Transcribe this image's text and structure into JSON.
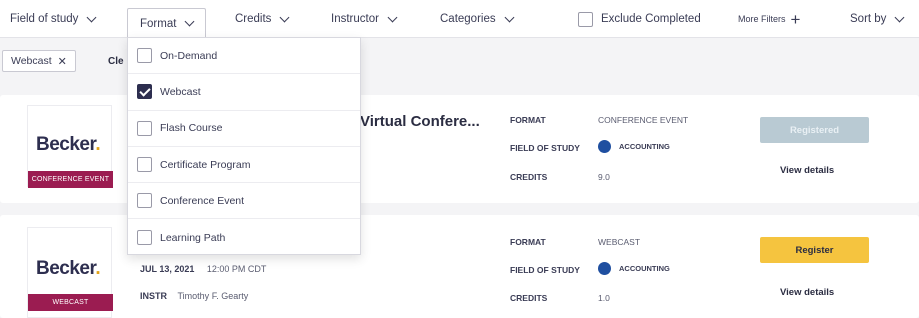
{
  "filter_bar": {
    "field_of_study": "Field of study",
    "format": "Format",
    "credits": "Credits",
    "instructor": "Instructor",
    "categories": "Categories",
    "exclude_completed": "Exclude Completed",
    "more_filters": "More Filters",
    "sort_by": "Sort by"
  },
  "active_filters": {
    "chip_label": "Webcast",
    "chip_remove": "✕",
    "clear_label": "Cle"
  },
  "format_dropdown": {
    "options": [
      {
        "label": "On-Demand",
        "checked": false
      },
      {
        "label": "Webcast",
        "checked": true
      },
      {
        "label": "Flash Course",
        "checked": false
      },
      {
        "label": "Certificate Program",
        "checked": false
      },
      {
        "label": "Conference Event",
        "checked": false
      },
      {
        "label": "Learning Path",
        "checked": false
      }
    ]
  },
  "courses": [
    {
      "logo": "Becker",
      "logo_dot": ".",
      "logo_band": "CONFERENCE EVENT",
      "title": "Virtual Confere...",
      "format_label": "FORMAT",
      "format_value": "CONFERENCE EVENT",
      "field_label": "FIELD OF STUDY",
      "field_value": "ACCOUNTING",
      "credits_label": "CREDITS",
      "credits_value": "9.0",
      "button": "Registered",
      "details": "View details"
    },
    {
      "logo": "Becker",
      "logo_dot": ".",
      "logo_band": "WEBCAST",
      "date": "JUL 13, 2021",
      "time": "12:00 PM CDT",
      "instr_label": "INSTR",
      "instr_value": "Timothy F. Gearty",
      "format_label": "FORMAT",
      "format_value": "WEBCAST",
      "field_label": "FIELD OF STUDY",
      "field_value": "ACCOUNTING",
      "credits_label": "CREDITS",
      "credits_value": "1.0",
      "button": "Register",
      "details": "View details"
    }
  ],
  "colors": {
    "brand_navy": "#2d2e4f",
    "brand_gold": "#e2a41b",
    "band_maroon": "#9b1c51",
    "register_yellow": "#f5c43f",
    "registered_gray": "#b9cad3",
    "field_dot_blue": "#1f4fa0"
  }
}
